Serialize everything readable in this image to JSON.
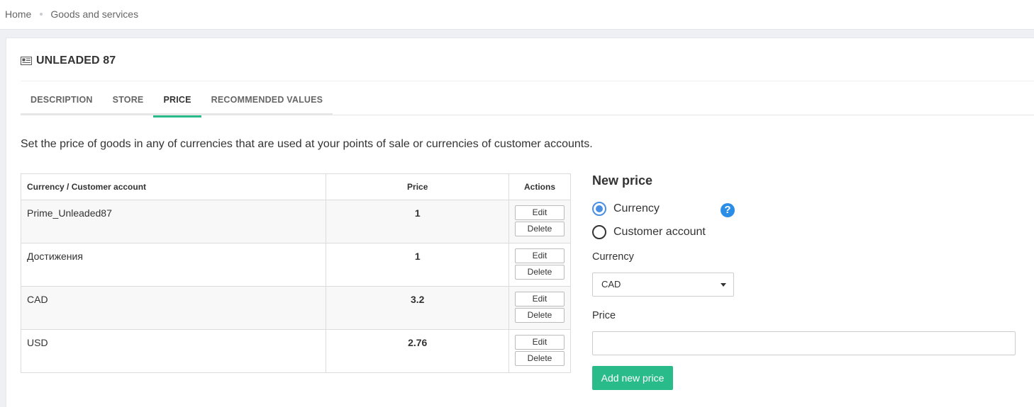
{
  "breadcrumb": {
    "home": "Home",
    "current": "Goods and services"
  },
  "page": {
    "title": "UNLEADED 87",
    "title_icon": "newspaper-icon"
  },
  "tabs": [
    {
      "label": "DESCRIPTION",
      "active": false
    },
    {
      "label": "STORE",
      "active": false
    },
    {
      "label": "PRICE",
      "active": true
    },
    {
      "label": "RECOMMENDED VALUES",
      "active": false
    }
  ],
  "description": "Set the price of goods in any of currencies that are used at your points of sale or currencies of customer accounts.",
  "table": {
    "headers": [
      "Currency / Customer account",
      "Price",
      "Actions"
    ],
    "rows": [
      {
        "name": "Prime_Unleaded87",
        "price": "1",
        "edit": "Edit",
        "delete": "Delete"
      },
      {
        "name": "Достижения",
        "price": "1",
        "edit": "Edit",
        "delete": "Delete"
      },
      {
        "name": "CAD",
        "price": "3.2",
        "edit": "Edit",
        "delete": "Delete"
      },
      {
        "name": "USD",
        "price": "2.76",
        "edit": "Edit",
        "delete": "Delete"
      }
    ]
  },
  "form": {
    "heading": "New price",
    "radio_currency": "Currency",
    "radio_account": "Customer account",
    "selected_radio": "currency",
    "help_icon": "question-circle-icon",
    "currency_label": "Currency",
    "currency_value": "CAD",
    "price_label": "Price",
    "price_value": "",
    "submit": "Add new price"
  },
  "colors": {
    "accent": "#29bb89",
    "radio_active": "#4a90e2",
    "help": "#2b8ee6"
  }
}
